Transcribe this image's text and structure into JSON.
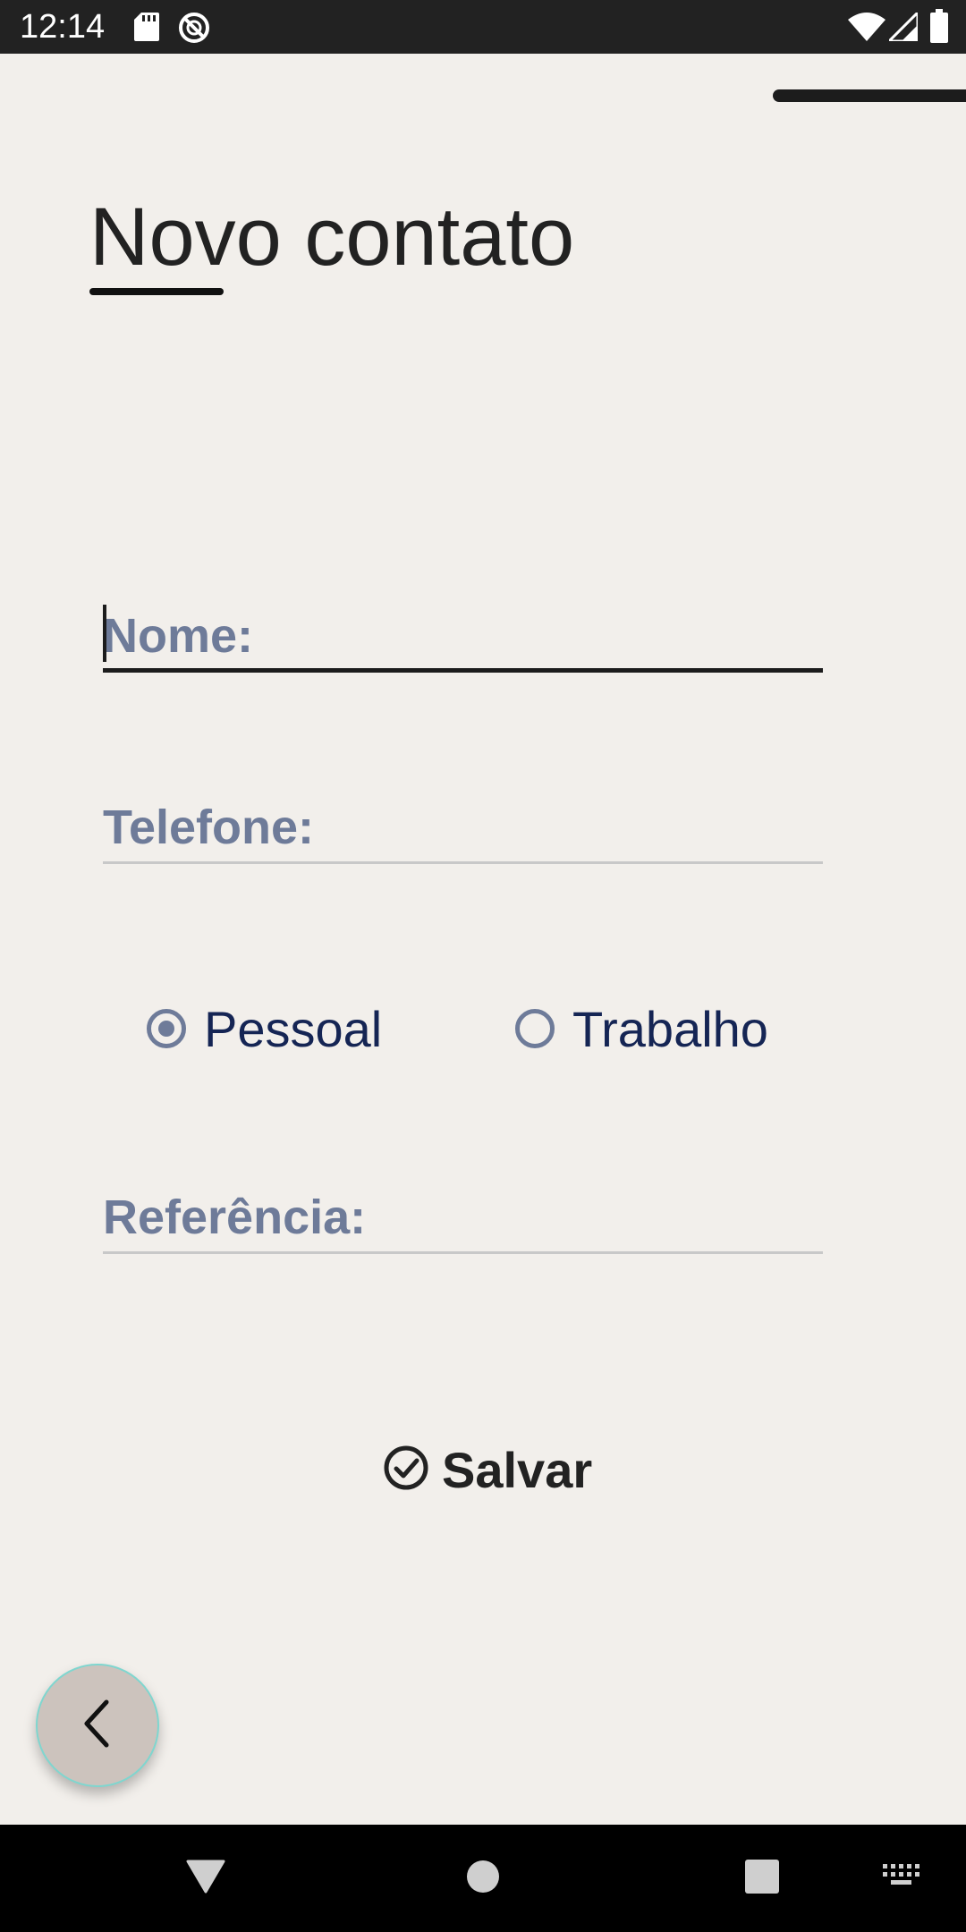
{
  "status_bar": {
    "time": "12:14",
    "left_icons": [
      "sd-card-icon",
      "no-sync-icon"
    ],
    "right_icons": [
      "wifi-icon",
      "cell-signal-icon",
      "battery-icon"
    ]
  },
  "page": {
    "title": "Novo contato"
  },
  "form": {
    "name_label": "Nome:",
    "phone_label": "Telefone:",
    "type_options": [
      {
        "label": "Pessoal",
        "checked": true
      },
      {
        "label": "Trabalho",
        "checked": false
      }
    ],
    "reference_label": "Referência:",
    "save_label": "Salvar"
  },
  "fab": {
    "icon": "chevron-left-icon"
  },
  "nav_bar": {
    "icons": [
      "back-triangle-icon",
      "home-circle-icon",
      "recents-square-icon",
      "keyboard-icon"
    ]
  },
  "colors": {
    "background": "#f2efeb",
    "label": "#6e7b99",
    "radio_text": "#152554",
    "text_dark": "#222222",
    "fab_bg": "#ccc3bd",
    "fab_border": "#7fd6cf"
  }
}
